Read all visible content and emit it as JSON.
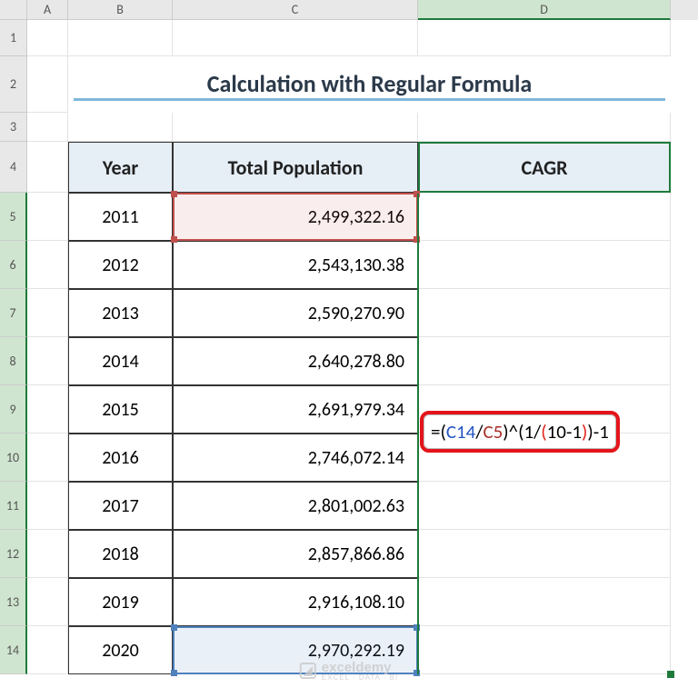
{
  "cols": {
    "A": "A",
    "B": "B",
    "C": "C",
    "D": "D"
  },
  "rows": [
    "1",
    "2",
    "3",
    "4",
    "5",
    "6",
    "7",
    "8",
    "9",
    "10",
    "11",
    "12",
    "13",
    "14"
  ],
  "title": "Calculation with Regular Formula",
  "headers": {
    "year": "Year",
    "pop": "Total Population",
    "cagr": "CAGR"
  },
  "data": [
    {
      "year": "2011",
      "pop": "2,499,322.16"
    },
    {
      "year": "2012",
      "pop": "2,543,130.38"
    },
    {
      "year": "2013",
      "pop": "2,590,270.90"
    },
    {
      "year": "2014",
      "pop": "2,640,278.80"
    },
    {
      "year": "2015",
      "pop": "2,691,979.34"
    },
    {
      "year": "2016",
      "pop": "2,746,072.14"
    },
    {
      "year": "2017",
      "pop": "2,801,002.63"
    },
    {
      "year": "2018",
      "pop": "2,857,866.86"
    },
    {
      "year": "2019",
      "pop": "2,916,108.10"
    },
    {
      "year": "2020",
      "pop": "2,970,292.19"
    }
  ],
  "formula": {
    "eq": "=",
    "p1": "(",
    "c14": "C14",
    "slash": "/",
    "c5": "C5",
    "p2": ")",
    "caret": "^(",
    "one": "1",
    "slash2": "/",
    "p3": "(",
    "ten": "10-1",
    "p4": ")",
    "p5": ")",
    "minus1": "-1"
  },
  "watermark": {
    "brand": "exceldemy",
    "tag": "EXCEL · DATA · BI"
  },
  "chart_data": {
    "type": "table",
    "title": "Calculation with Regular Formula",
    "columns": [
      "Year",
      "Total Population",
      "CAGR"
    ],
    "rows": [
      [
        "2011",
        2499322.16,
        null
      ],
      [
        "2012",
        2543130.38,
        null
      ],
      [
        "2013",
        2590270.9,
        null
      ],
      [
        "2014",
        2640278.8,
        null
      ],
      [
        "2015",
        2691979.34,
        null
      ],
      [
        "2016",
        2746072.14,
        null
      ],
      [
        "2017",
        2801002.63,
        null
      ],
      [
        "2018",
        2857866.86,
        null
      ],
      [
        "2019",
        2916108.1,
        null
      ],
      [
        "2020",
        2970292.19,
        null
      ]
    ],
    "formula_cell": {
      "address": "D9",
      "formula": "=(C14/C5)^(1/(10-1))-1"
    }
  }
}
